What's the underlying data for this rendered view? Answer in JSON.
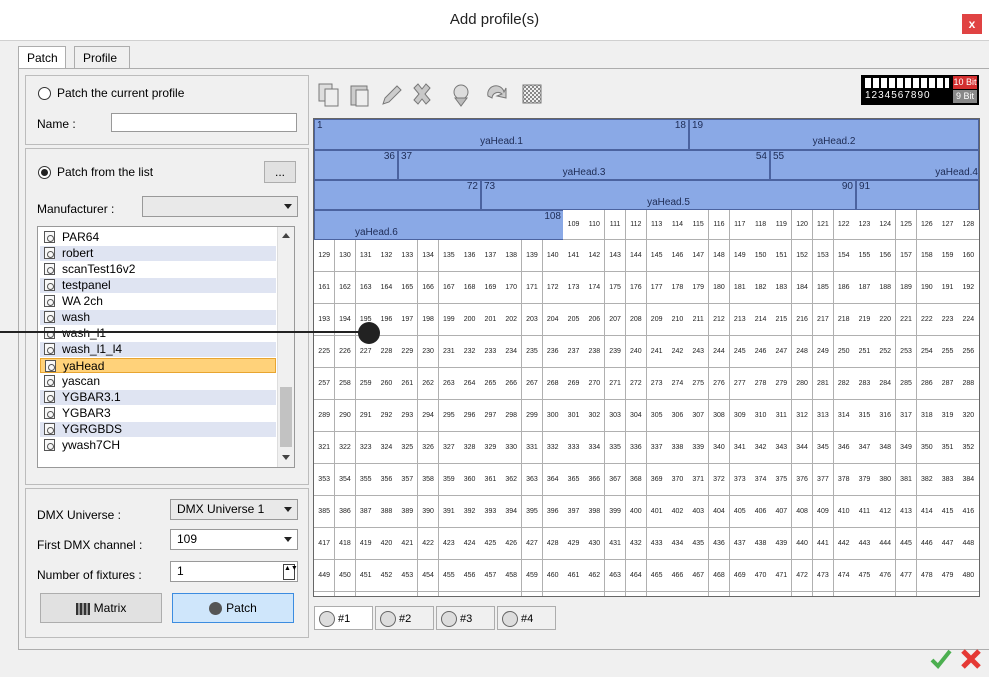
{
  "window": {
    "title": "Add profile(s)",
    "close": "x"
  },
  "tabs": [
    "Patch",
    "Profile"
  ],
  "patch_current": {
    "label": "Patch the current profile",
    "name_label": "Name :",
    "name_value": ""
  },
  "patch_list": {
    "label": "Patch from the list",
    "browse": "...",
    "manufacturer_label": "Manufacturer :",
    "manufacturer_value": ""
  },
  "profiles": [
    "PAR64",
    "robert",
    "scanTest16v2",
    "testpanel",
    "WA 2ch",
    "wash",
    "wash_l1",
    "wash_l1_l4",
    "yaHead",
    "yascan",
    "YGBAR3.1",
    "YGBAR3",
    "YGRGBDS",
    "ywash7CH"
  ],
  "selected_profile": "yaHead",
  "settings": {
    "universe_label": "DMX Universe :",
    "universe_value": "DMX Universe 1",
    "channel_label": "First DMX channel :",
    "channel_value": "109",
    "count_label": "Number of fixtures :",
    "count_value": "1"
  },
  "buttons": {
    "matrix": "Matrix",
    "patch": "Patch"
  },
  "bit_box": {
    "top": "10 Bit",
    "bottom": "9 Bit",
    "digits": "1234567890"
  },
  "fixtures": [
    {
      "name": "yaHead.1",
      "start": "1",
      "end": "18"
    },
    {
      "name": "yaHead.2",
      "start": "19",
      "end": ""
    },
    {
      "name": "yaHead.3",
      "start": "37",
      "end": "54"
    },
    {
      "name": "yaHead.4",
      "start": "55",
      "end": ""
    },
    {
      "name": "yaHead.5",
      "start": "73",
      "end": "90"
    },
    {
      "name": "yaHead.6",
      "start": "",
      "end": "108"
    }
  ],
  "extra_labels": {
    "r2_end": "36",
    "r3_end": "72",
    "r3_right": "91"
  },
  "universe_tabs": [
    "#1",
    "#2",
    "#3",
    "#4"
  ]
}
